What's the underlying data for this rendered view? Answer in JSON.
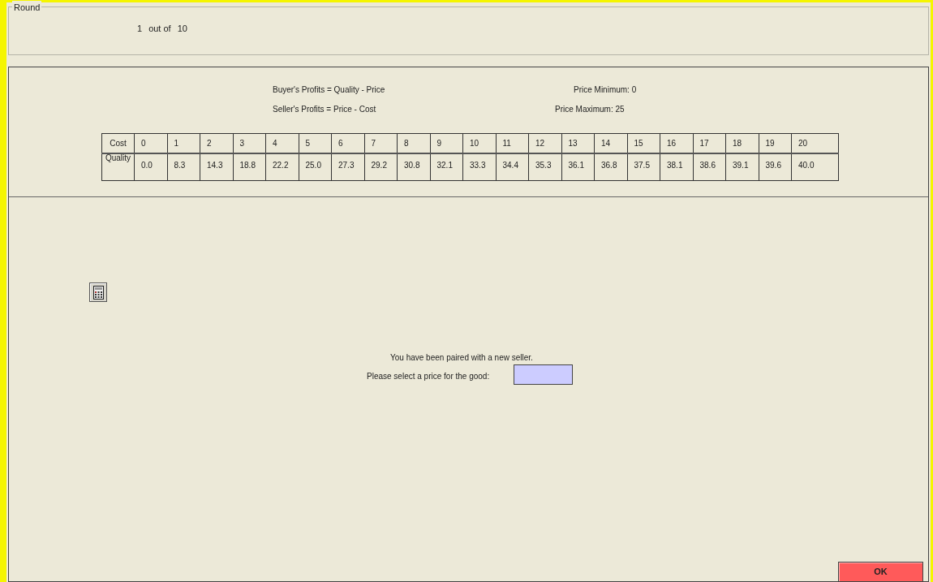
{
  "round_group": {
    "title": "Round",
    "current_round": "1",
    "out_of": "out of",
    "total_rounds": "10"
  },
  "formulas": [
    "Buyer's Profits = Quality - Price",
    "Seller's Profits = Price - Cost"
  ],
  "price_limits": [
    "Price Minimum: 0",
    "Price Maximum: 25"
  ],
  "table": {
    "row_headers": [
      "Cost",
      "Quality"
    ],
    "cost": [
      "0",
      "1",
      "2",
      "3",
      "4",
      "5",
      "6",
      "7",
      "8",
      "9",
      "10",
      "11",
      "12",
      "13",
      "14",
      "15",
      "16",
      "17",
      "18",
      "19",
      "20"
    ],
    "quality": [
      "0.0",
      "8.3",
      "14.3",
      "18.8",
      "22.2",
      "25.0",
      "27.3",
      "29.2",
      "30.8",
      "32.1",
      "33.3",
      "34.4",
      "35.3",
      "36.1",
      "36.8",
      "37.5",
      "38.1",
      "38.6",
      "39.1",
      "39.6",
      "40.0"
    ]
  },
  "message": "You have been paired with a new seller.",
  "price_prompt": {
    "label": "Please select a price for the good:"
  },
  "ok_button": "OK"
}
